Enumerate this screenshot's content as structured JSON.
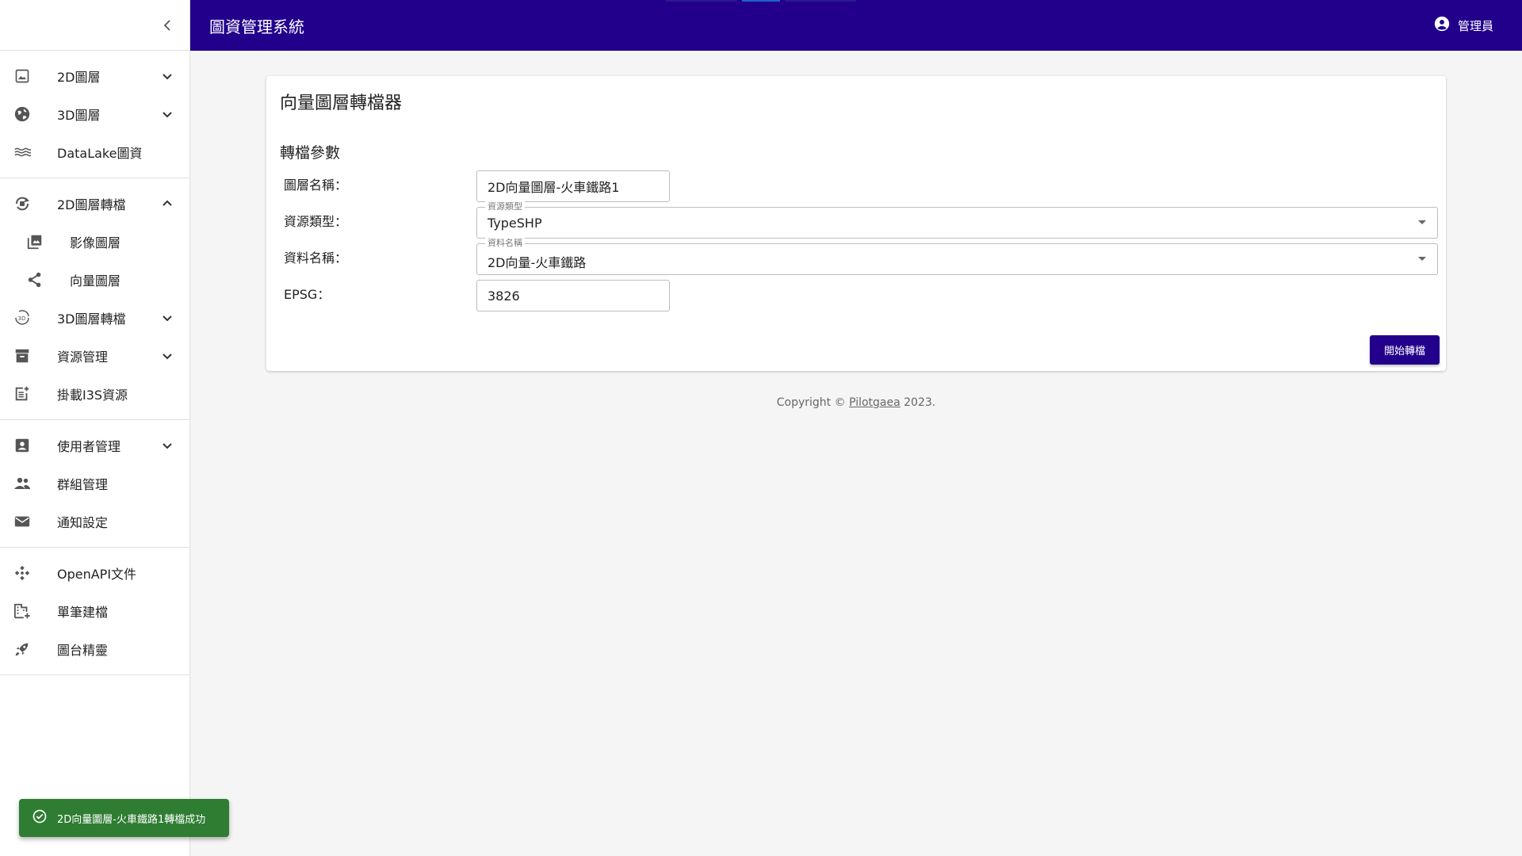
{
  "header": {
    "title": "圖資管理系統",
    "user_label": "管理員",
    "accent": "#22008c"
  },
  "sidebar": {
    "groups": [
      [
        {
          "label": "2D圖層",
          "icon": "image-icon",
          "chevron": "down"
        },
        {
          "label": "3D圖層",
          "icon": "globe-icon",
          "chevron": "down"
        },
        {
          "label": "DataLake圖資",
          "icon": "waves-icon"
        }
      ],
      [
        {
          "label": "2D圖層轉檔",
          "icon": "sync-layer-icon",
          "chevron": "up"
        },
        {
          "label": "影像圖層",
          "icon": "photo-library-icon",
          "sub": true
        },
        {
          "label": "向量圖層",
          "icon": "share-nodes-icon",
          "sub": true
        },
        {
          "label": "3D圖層轉檔",
          "icon": "rotate-3d-icon",
          "chevron": "down"
        },
        {
          "label": "資源管理",
          "icon": "archive-icon",
          "chevron": "down"
        },
        {
          "label": "掛載I3S資源",
          "icon": "post-add-icon"
        }
      ],
      [
        {
          "label": "使用者管理",
          "icon": "account-box-icon",
          "chevron": "down"
        },
        {
          "label": "群組管理",
          "icon": "people-icon"
        },
        {
          "label": "通知設定",
          "icon": "mail-icon"
        }
      ],
      [
        {
          "label": "OpenAPI文件",
          "icon": "api-icon"
        },
        {
          "label": "單筆建檔",
          "icon": "domain-add-icon"
        },
        {
          "label": "圖台精靈",
          "icon": "rocket-icon"
        }
      ]
    ]
  },
  "card": {
    "title": "向量圖層轉檔器",
    "section_title": "轉檔參數",
    "fields": {
      "layer_name": {
        "label": "圖層名稱：",
        "value": "2D向量圖層-火車鐵路1"
      },
      "source_type": {
        "label": "資源類型：",
        "legend": "資源類型",
        "value": "TypeSHP"
      },
      "data_name": {
        "label": "資料名稱：",
        "legend": "資料名稱",
        "value": "2D向量-火車鐵路"
      },
      "epsg": {
        "label": "EPSG：",
        "value": "3826"
      }
    },
    "submit_label": "開始轉檔"
  },
  "footer": {
    "prefix": "Copyright © ",
    "link": "Pilotgaea",
    "suffix": " 2023."
  },
  "snackbar": {
    "message": "2D向量圖層-火車鐵路1轉檔成功",
    "color": "#2e7d32"
  }
}
